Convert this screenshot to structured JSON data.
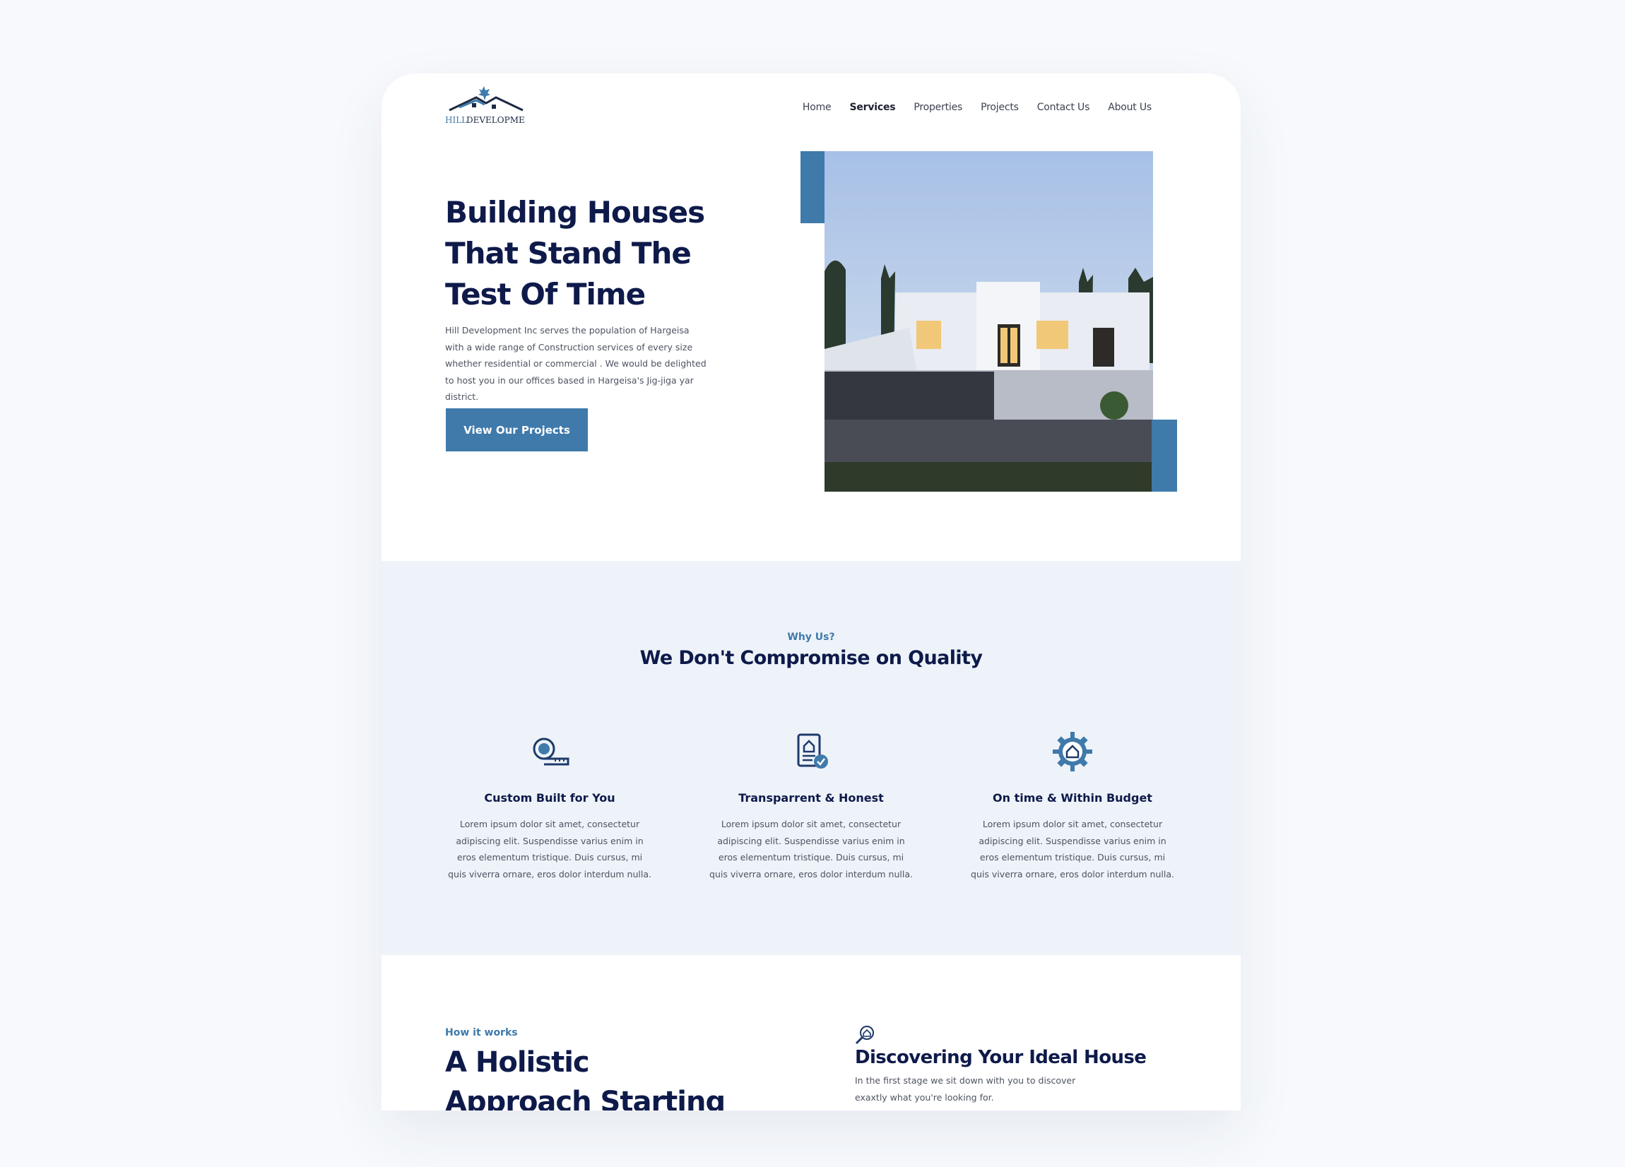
{
  "header": {
    "logo_text_hill": "HILL",
    "logo_text_dev": "DEVELOPMENT",
    "nav": [
      {
        "label": "Home"
      },
      {
        "label": "Services"
      },
      {
        "label": "Properties"
      },
      {
        "label": "Projects"
      },
      {
        "label": "Contact Us"
      },
      {
        "label": "About Us"
      }
    ]
  },
  "hero": {
    "title": "Building Houses That Stand The Test Of Time",
    "description": "Hill Development Inc serves the population of Hargeisa with a wide range of Construction services of every size whether residential or commercial . We would be delighted to host you in our offices based in Hargeisa's Jig-jiga yar district.",
    "cta_label": "View Our Projects"
  },
  "why_us": {
    "eyebrow": "Why Us?",
    "title": "We Don't Compromise on Quality",
    "features": [
      {
        "icon": "tape-measure-icon",
        "title": "Custom Built for You",
        "text": "Lorem ipsum dolor sit amet, consectetur adipiscing elit. Suspendisse varius enim in eros elementum tristique. Duis cursus, mi quis viverra ornare, eros dolor interdum nulla."
      },
      {
        "icon": "document-check-icon",
        "title": "Transparrent & Honest",
        "text": "Lorem ipsum dolor sit amet, consectetur adipiscing elit. Suspendisse varius enim in eros elementum tristique. Duis cursus, mi quis viverra ornare, eros dolor interdum nulla."
      },
      {
        "icon": "gear-house-icon",
        "title": "On time & Within Budget",
        "text": "Lorem ipsum dolor sit amet, consectetur adipiscing elit. Suspendisse varius enim in eros elementum tristique. Duis cursus, mi quis viverra ornare, eros dolor interdum nulla."
      }
    ]
  },
  "how_it_works": {
    "eyebrow": "How it works",
    "title": "A Holistic Approach Starting From Design",
    "step": {
      "icon": "house-search-icon",
      "title": "Discovering Your Ideal House",
      "text": "In the first stage we sit down with you to discover exaxtly what you're looking for."
    }
  },
  "colors": {
    "accent": "#3f7aab",
    "heading": "#0e1a4a",
    "section_bg": "#eef3f9"
  }
}
